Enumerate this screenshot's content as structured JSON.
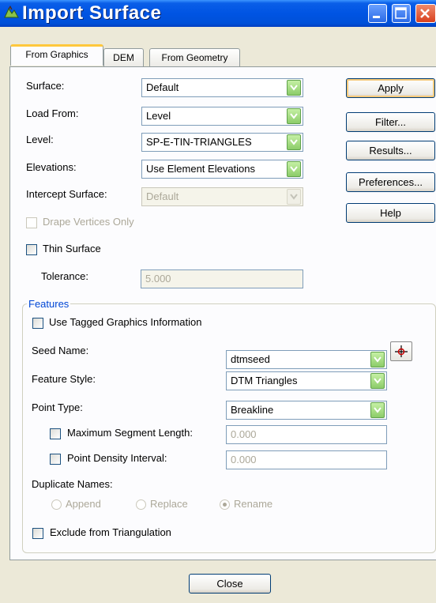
{
  "window": {
    "title": "Import Surface"
  },
  "tabs": [
    {
      "label": "From Graphics",
      "active": true
    },
    {
      "label": "DEM",
      "active": false
    },
    {
      "label": "From Geometry",
      "active": false
    }
  ],
  "form": {
    "surface": {
      "label": "Surface:",
      "value": "Default"
    },
    "load_from": {
      "label": "Load From:",
      "value": "Level"
    },
    "level": {
      "label": "Level:",
      "value": "SP-E-TIN-TRIANGLES"
    },
    "elevations": {
      "label": "Elevations:",
      "value": "Use Element Elevations"
    },
    "intercept_surface": {
      "label": "Intercept Surface:",
      "value": "Default",
      "disabled": true
    },
    "drape_vertices_only": {
      "label": "Drape Vertices Only",
      "checked": false,
      "disabled": true
    },
    "thin_surface": {
      "label": "Thin Surface",
      "checked": false
    },
    "tolerance": {
      "label": "Tolerance:",
      "value": "5.000",
      "disabled": true
    }
  },
  "features": {
    "title": "Features",
    "use_tagged": {
      "label": "Use Tagged Graphics Information",
      "checked": false
    },
    "seed_name": {
      "label": "Seed Name:",
      "value": "dtmseed"
    },
    "feature_style": {
      "label": "Feature Style:",
      "value": "DTM Triangles"
    },
    "point_type": {
      "label": "Point Type:",
      "value": "Breakline"
    },
    "max_segment_length": {
      "label": "Maximum Segment Length:",
      "value": "0.000",
      "checked": false
    },
    "point_density_interval": {
      "label": "Point Density Interval:",
      "value": "0.000",
      "checked": false
    },
    "duplicate_names": {
      "label": "Duplicate Names:",
      "options": [
        "Append",
        "Replace",
        "Rename"
      ],
      "selected": "Rename"
    },
    "exclude_from_triangulation": {
      "label": "Exclude from Triangulation",
      "checked": false
    }
  },
  "buttons": {
    "apply": "Apply",
    "filter": "Filter...",
    "results": "Results...",
    "preferences": "Preferences...",
    "help": "Help",
    "close": "Close"
  },
  "colors": {
    "title_bar": "#0054e3",
    "group_title": "#0046d5",
    "combo_arrow": "#8ccc69"
  }
}
